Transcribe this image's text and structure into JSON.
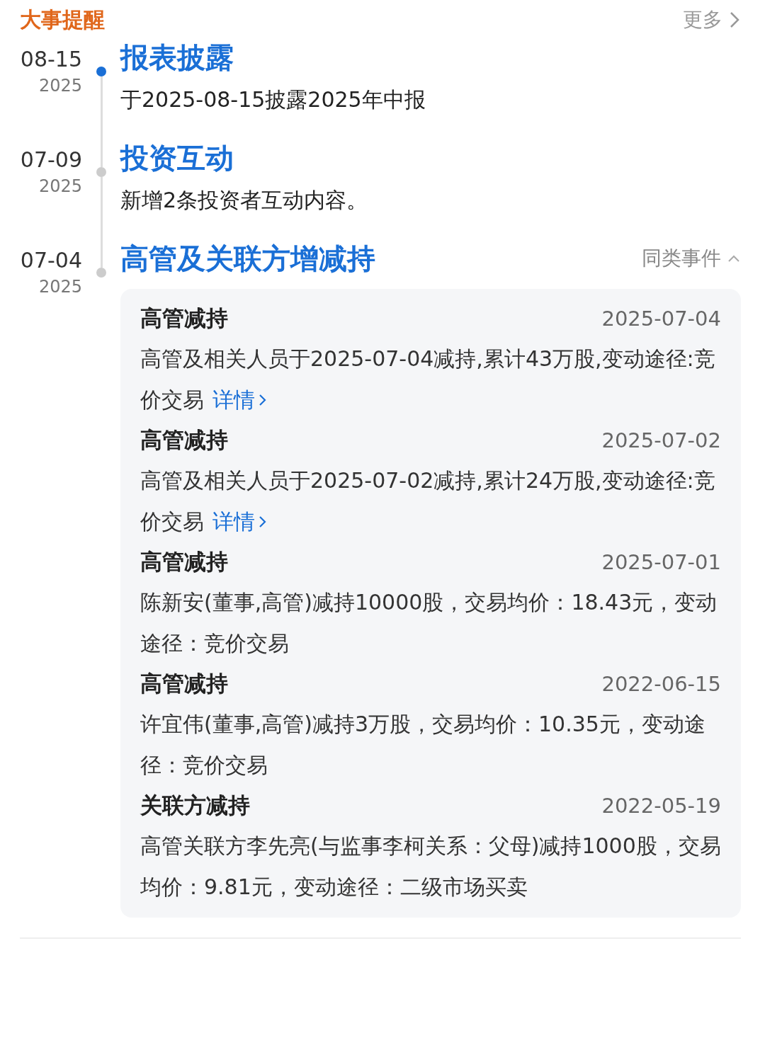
{
  "header": {
    "title": "大事提醒",
    "more": "更多"
  },
  "events": [
    {
      "date": "08-15",
      "year": "2025",
      "active": true,
      "title": "报表披露",
      "desc": "于2025-08-15披露2025年中报"
    },
    {
      "date": "07-09",
      "year": "2025",
      "active": false,
      "title": "投资互动",
      "desc": "新增2条投资者互动内容。"
    },
    {
      "date": "07-04",
      "year": "2025",
      "active": false,
      "title": "高管及关联方增减持",
      "similar": {
        "label": "同类事件",
        "expanded": true
      },
      "records": [
        {
          "title": "高管减持",
          "date": "2025-07-04",
          "text": "高管及相关人员于2025-07-04减持,累计43万股,变动途径:竞价交易",
          "link": "详情"
        },
        {
          "title": "高管减持",
          "date": "2025-07-02",
          "text": "高管及相关人员于2025-07-02减持,累计24万股,变动途径:竞价交易",
          "link": "详情"
        },
        {
          "title": "高管减持",
          "date": "2025-07-01",
          "text": "陈新安(董事,高管)减持10000股，交易均价：18.43元，变动途径：竞价交易"
        },
        {
          "title": "高管减持",
          "date": "2022-06-15",
          "text": "许宜伟(董事,高管)减持3万股，交易均价：10.35元，变动途径：竞价交易"
        },
        {
          "title": "关联方减持",
          "date": "2022-05-19",
          "text": "高管关联方李先亮(与监事李柯关系：父母)减持1000股，交易均价：9.81元，变动途径：二级市场买卖"
        }
      ]
    }
  ]
}
